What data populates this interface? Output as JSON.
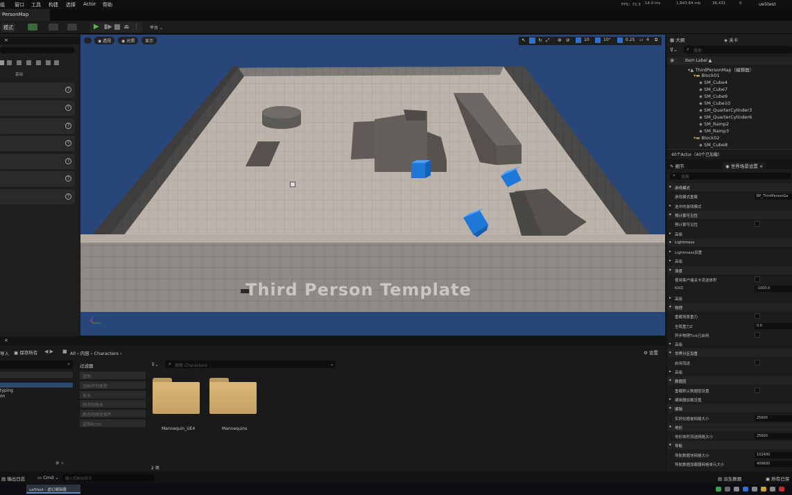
{
  "menu": {
    "items": [
      "组",
      "窗口",
      "工具",
      "构建",
      "选择",
      "Actor",
      "帮助"
    ]
  },
  "perf": {
    "fps": "FPS：71.3",
    "ms": "14.0 ms",
    "mem": "1,843.64 mb",
    "objects": "36,431",
    "stat": "0",
    "project": "ue5test"
  },
  "map_tab": "PersonMap",
  "toolbar": {
    "mode": "模式",
    "play_label": "平台"
  },
  "viewport": {
    "btn_perspective": "透视",
    "btn_lit": "光照",
    "btn_show": "显示",
    "grid": "10",
    "angle": "10°",
    "scale": "0.25",
    "cams": "4",
    "floor_text": "Third Person Template"
  },
  "left_panel": {
    "section": "基础"
  },
  "outliner": {
    "tab1": "大纲",
    "tab2": "关卡",
    "search_placeholder": "搜索",
    "col_label": "Item Label ▲",
    "items": [
      {
        "label": "ThirdPersonMap（编辑器）",
        "indent": 0
      },
      {
        "label": "Block01",
        "indent": 1
      },
      {
        "label": "SM_Cube4",
        "indent": 2
      },
      {
        "label": "SM_Cube7",
        "indent": 2
      },
      {
        "label": "SM_Cube9",
        "indent": 2
      },
      {
        "label": "SM_Cube10",
        "indent": 2
      },
      {
        "label": "SM_QuarterCylinder3",
        "indent": 2
      },
      {
        "label": "SM_QuarterCylinder6",
        "indent": 2
      },
      {
        "label": "SM_Ramp2",
        "indent": 2
      },
      {
        "label": "SM_Ramp3",
        "indent": 2
      },
      {
        "label": "Block02",
        "indent": 1
      },
      {
        "label": "SM_Cube8",
        "indent": 2
      }
    ],
    "footer": "40个Actor（40个已加载）"
  },
  "details": {
    "tab1": "细节",
    "tab2": "世界场景设置",
    "search_placeholder": "搜索",
    "rows": [
      {
        "type": "sec",
        "label": "游戏模式"
      },
      {
        "type": "val",
        "label": "游戏模式重载",
        "value": "BP_ThirdPersonGa"
      },
      {
        "type": "plain",
        "label": "选中的游戏模式"
      },
      {
        "type": "sec",
        "label": "预计算可见性"
      },
      {
        "type": "chk",
        "label": "预计算可见性"
      },
      {
        "type": "plain",
        "label": "高级"
      },
      {
        "type": "sec",
        "label": "Lightmass"
      },
      {
        "type": "plain",
        "label": "Lightmass设置"
      },
      {
        "type": "plain",
        "label": "高级"
      },
      {
        "type": "sec",
        "label": "场景"
      },
      {
        "type": "chk",
        "label": "使用客户端关卡流送体积"
      },
      {
        "type": "val",
        "label": "KillZ",
        "value": "-1000.0"
      },
      {
        "type": "plain",
        "label": "高级"
      },
      {
        "type": "sec",
        "label": "物理"
      },
      {
        "type": "chk",
        "label": "重载场景重力"
      },
      {
        "type": "val",
        "label": "全局重力Z",
        "value": "0.0"
      },
      {
        "type": "chk",
        "label": "异步物理Tick已启用"
      },
      {
        "type": "plain",
        "label": "高级"
      },
      {
        "type": "sec",
        "label": "世界分区设置"
      },
      {
        "type": "chk",
        "label": "启用流送"
      },
      {
        "type": "plain",
        "label": "高级"
      },
      {
        "type": "sec",
        "label": "数据层"
      },
      {
        "type": "chk",
        "label": "重载默认数据层设置"
      },
      {
        "type": "plain",
        "label": "编辑器加载设置"
      },
      {
        "type": "sec",
        "label": "编辑"
      },
      {
        "type": "val",
        "label": "实例化植被网格大小",
        "value": "25600"
      },
      {
        "type": "sec",
        "label": "地形"
      },
      {
        "type": "val",
        "label": "地形体积流送网格大小",
        "value": "25600"
      },
      {
        "type": "sec",
        "label": "导航"
      },
      {
        "type": "val",
        "label": "导航数据块网格大小",
        "value": "102400"
      },
      {
        "type": "val",
        "label": "导航数据加载器网格单元大小",
        "value": "409600"
      }
    ]
  },
  "content": {
    "import": "导入",
    "save_all": "保存所有",
    "path": [
      "All",
      "内容",
      "Characters"
    ],
    "settings": "设置",
    "filters_title": "过滤器",
    "filters": [
      "蓝图",
      "动画序列类型",
      "关卡",
      "静态网格体",
      "静态网格体插件",
      "蓝图Actor"
    ],
    "search_placeholder": "搜索 Characters",
    "folders": [
      "Mannequin_UE4",
      "Mannequins"
    ],
    "count": "2 项",
    "tree": [
      "typing",
      "on"
    ]
  },
  "bottom": {
    "output_log": "输出日志",
    "cmd": "Cmd",
    "cmd_placeholder": "输入控制台命令",
    "derived": "派生数据",
    "all_saved": "所有已保"
  },
  "taskbar": {
    "app": "ue5test - 虚幻编辑器"
  }
}
